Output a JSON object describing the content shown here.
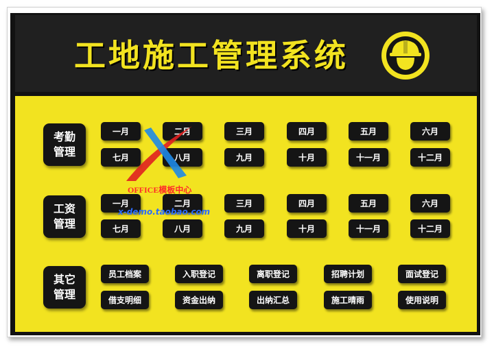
{
  "app": {
    "title": "工地施工管理系统",
    "icon": "hard-hat-worker-icon",
    "colors": {
      "accent": "#f2e320",
      "dark": "#151515",
      "header": "#202020"
    }
  },
  "sections": {
    "attendance": {
      "label": "考勤管理",
      "months": [
        "一月",
        "二月",
        "三月",
        "四月",
        "五月",
        "六月",
        "七月",
        "八月",
        "九月",
        "十月",
        "十一月",
        "十二月"
      ]
    },
    "salary": {
      "label": "工资管理",
      "months": [
        "一月",
        "二月",
        "三月",
        "四月",
        "五月",
        "六月",
        "七月",
        "八月",
        "九月",
        "十月",
        "十一月",
        "十二月"
      ]
    },
    "other": {
      "label": "其它管理",
      "items": [
        "员工档案",
        "入职登记",
        "离职登记",
        "招聘计划",
        "面试登记",
        "借支明细",
        "资金出纳",
        "出纳汇总",
        "施工晴雨",
        "使用说明"
      ]
    }
  },
  "watermark": {
    "line1": "OFFICE模板中心",
    "line2": "x-demo.taobao.com"
  }
}
